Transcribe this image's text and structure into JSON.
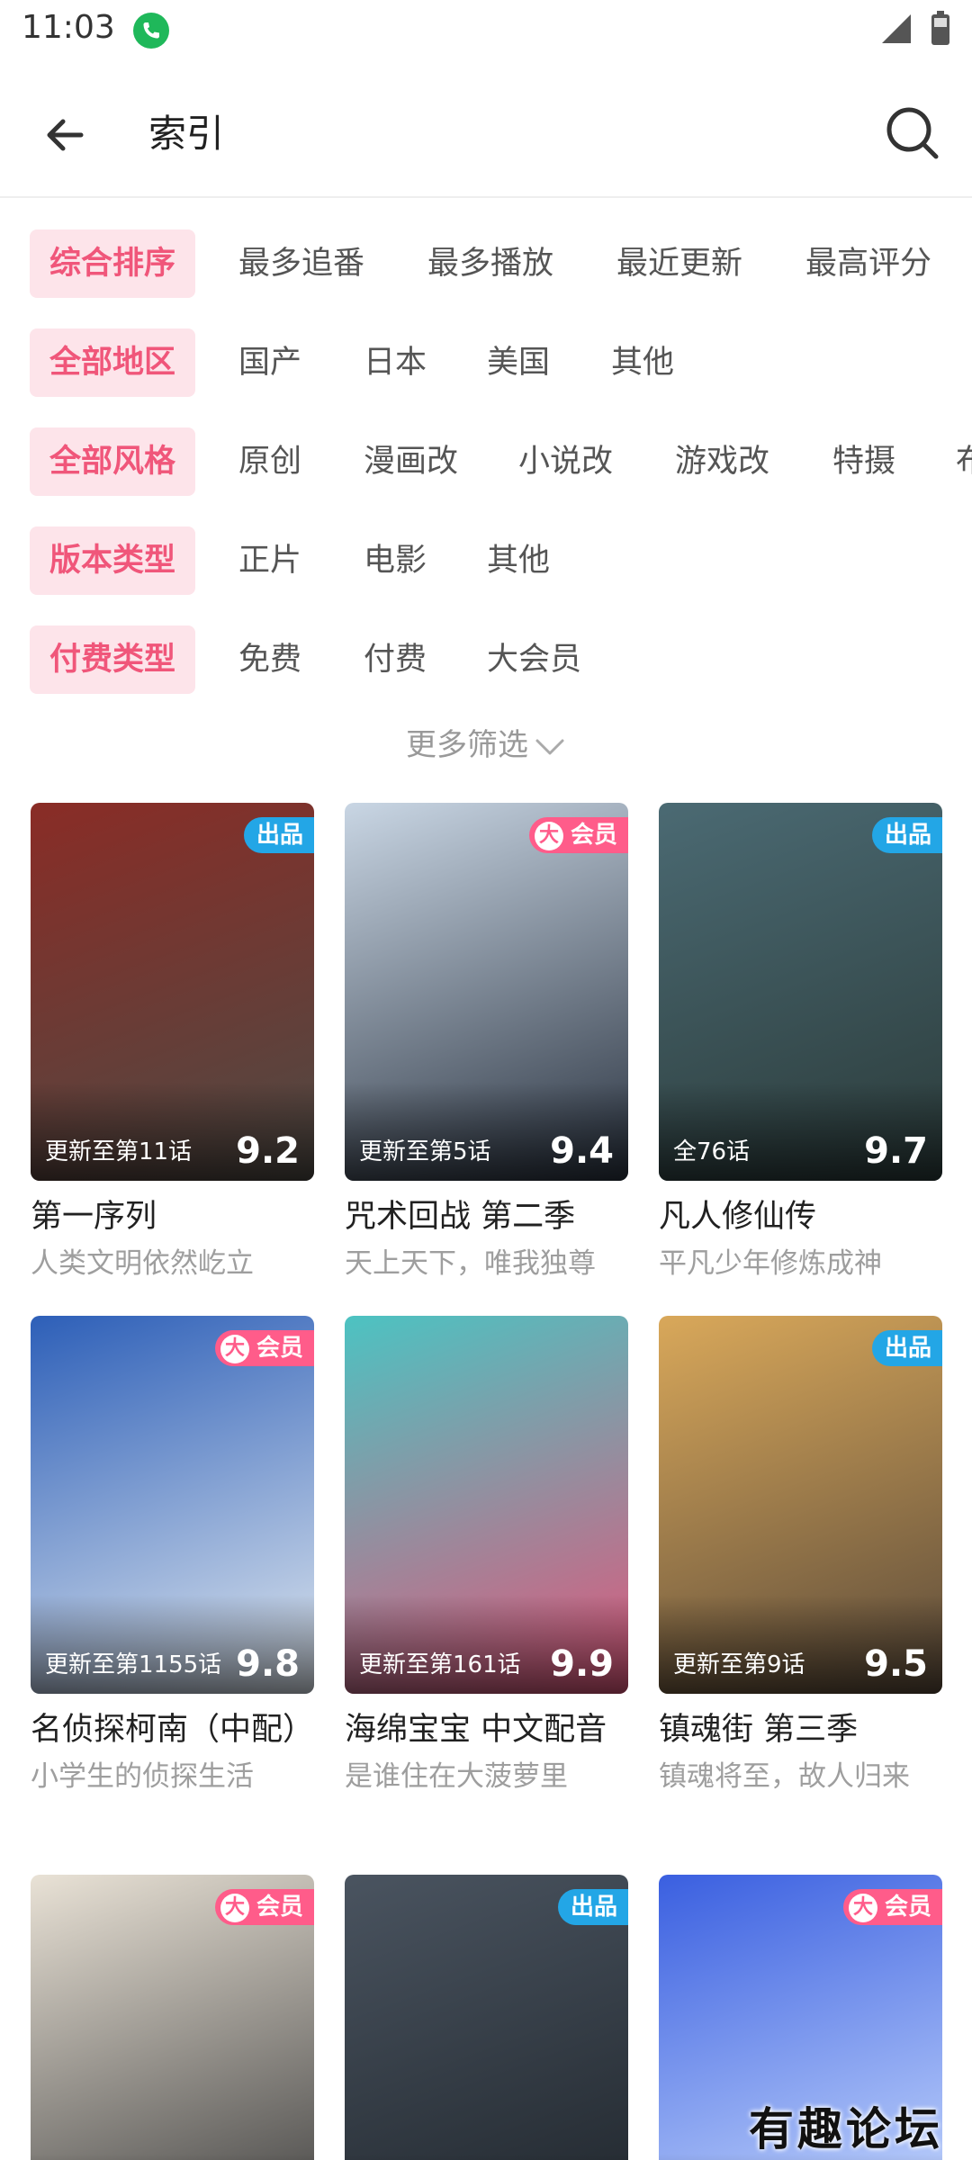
{
  "status_bar": {
    "time": "11:03",
    "icons": [
      "call-icon",
      "signal-icon",
      "battery-icon"
    ]
  },
  "app_bar": {
    "title": "索引",
    "back_icon": "arrow-left-icon",
    "search_icon": "search-icon"
  },
  "filters": {
    "sort": [
      "综合排序",
      "最多追番",
      "最多播放",
      "最近更新",
      "最高评分"
    ],
    "region": [
      "全部地区",
      "国产",
      "日本",
      "美国",
      "其他"
    ],
    "style": [
      "全部风格",
      "原创",
      "漫画改",
      "小说改",
      "游戏改",
      "特摄",
      "布"
    ],
    "version": [
      "版本类型",
      "正片",
      "电影",
      "其他"
    ],
    "pay": [
      "付费类型",
      "免费",
      "付费",
      "大会员"
    ],
    "more_label": "更多筛选"
  },
  "badges": {
    "pro": "出品",
    "vip": "会员",
    "vip_mark": "大"
  },
  "cards": [
    {
      "title": "第一序列",
      "subtitle": "人类文明依然屹立",
      "episode": "更新至第11话",
      "score": "9.2",
      "badge": "pro",
      "colors": [
        "#8a2c26",
        "#4d4a44"
      ]
    },
    {
      "title": "咒术回战 第二季",
      "subtitle": "天上天下，唯我独尊",
      "episode": "更新至第5话",
      "score": "9.4",
      "badge": "vip",
      "colors": [
        "#c9d6e4",
        "#2a3340"
      ]
    },
    {
      "title": "凡人修仙传",
      "subtitle": "平凡少年修炼成神",
      "episode": "全76话",
      "score": "9.7",
      "badge": "pro",
      "colors": [
        "#4b6a73",
        "#2b3b3a"
      ]
    },
    {
      "title": "名侦探柯南（中配）",
      "subtitle": "小学生的侦探生活",
      "episode": "更新至第1155话",
      "score": "9.8",
      "badge": "vip",
      "colors": [
        "#2d5fb8",
        "#dfe7ef"
      ]
    },
    {
      "title": "海绵宝宝 中文配音",
      "subtitle": "是谁住在大菠萝里",
      "episode": "更新至第161话",
      "score": "9.9",
      "badge": "",
      "colors": [
        "#4cc3c2",
        "#e0567a"
      ]
    },
    {
      "title": "镇魂街 第三季",
      "subtitle": "镇魂将至，故人归来",
      "episode": "更新至第9话",
      "score": "9.5",
      "badge": "pro",
      "colors": [
        "#d9a85a",
        "#5a4a3a"
      ]
    },
    {
      "title": "",
      "subtitle": "",
      "episode": "",
      "score": "",
      "badge": "vip",
      "colors": [
        "#e9e2d6",
        "#3a3a3a"
      ]
    },
    {
      "title": "",
      "subtitle": "",
      "episode": "",
      "score": "",
      "badge": "pro",
      "colors": [
        "#4a5460",
        "#1e242a"
      ]
    },
    {
      "title": "",
      "subtitle": "",
      "episode": "",
      "score": "",
      "badge": "vip",
      "colors": [
        "#3a5fe0",
        "#cfe0ff"
      ]
    }
  ],
  "watermark": "有趣论坛"
}
